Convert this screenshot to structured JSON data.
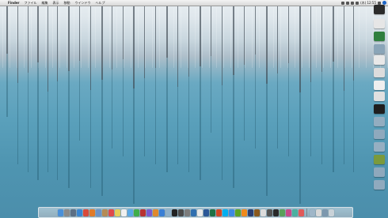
{
  "menubar": {
    "apple_symbol": "",
    "app_name": "Finder",
    "items": [
      "ファイル",
      "編集",
      "表示",
      "移動",
      "ウインドウ",
      "ヘルプ"
    ],
    "clock": "(木) 12:55",
    "status_icons": [
      "wifi-icon",
      "volume-icon",
      "battery-icon",
      "flag-icon",
      "user-icon"
    ]
  },
  "desktop": {
    "wallpaper": "snowy-trees-blue-pond",
    "icons": [
      {
        "name": "hard-drive-icon",
        "color": "#2b2b2b"
      },
      {
        "name": "document-icon",
        "color": "#e6e6e6"
      },
      {
        "name": "app-icon",
        "color": "#2f7f3e"
      },
      {
        "name": "folder-icon",
        "color": "#8aa5b8"
      },
      {
        "name": "document-icon",
        "color": "#e8e8e8"
      },
      {
        "name": "document-icon",
        "color": "#dcdcdc"
      },
      {
        "name": "document-icon",
        "color": "#efefef"
      },
      {
        "name": "document-icon",
        "color": "#e0e0e0"
      },
      {
        "name": "terminal-icon",
        "color": "#1e1e1e"
      },
      {
        "name": "folder-icon",
        "color": "#93adc0"
      },
      {
        "name": "folder-icon",
        "color": "#8fa9bd"
      },
      {
        "name": "folder-icon",
        "color": "#96afc2"
      },
      {
        "name": "image-icon",
        "color": "#7b9a3c"
      },
      {
        "name": "folder-icon",
        "color": "#8ea8bc"
      },
      {
        "name": "folder-icon",
        "color": "#90aabe"
      }
    ]
  },
  "dock": {
    "apps": [
      {
        "name": "finder-icon",
        "color": "#4a90d9"
      },
      {
        "name": "launchpad-icon",
        "color": "#8a8a8a"
      },
      {
        "name": "mission-control-icon",
        "color": "#5b6f85"
      },
      {
        "name": "safari-icon",
        "color": "#3a86d1"
      },
      {
        "name": "chrome-icon",
        "color": "#d94a3a"
      },
      {
        "name": "firefox-icon",
        "color": "#e07b2a"
      },
      {
        "name": "mail-icon",
        "color": "#6b93c9"
      },
      {
        "name": "contacts-icon",
        "color": "#b58b55"
      },
      {
        "name": "calendar-icon",
        "color": "#e04a4a"
      },
      {
        "name": "notes-icon",
        "color": "#e6cf5a"
      },
      {
        "name": "reminders-icon",
        "color": "#f0f0f0"
      },
      {
        "name": "messages-icon",
        "color": "#5aa9e6"
      },
      {
        "name": "facetime-icon",
        "color": "#3fae4a"
      },
      {
        "name": "photo-booth-icon",
        "color": "#b83232"
      },
      {
        "name": "itunes-icon",
        "color": "#7a5bd1"
      },
      {
        "name": "ibooks-icon",
        "color": "#e08a2e"
      },
      {
        "name": "app-store-icon",
        "color": "#3a7fd5"
      },
      {
        "name": "preview-icon",
        "color": "#8fb0c9"
      },
      {
        "name": "terminal-icon",
        "color": "#222222"
      },
      {
        "name": "activity-monitor-icon",
        "color": "#4a4a4a"
      },
      {
        "name": "system-preferences-icon",
        "color": "#7c7c7c"
      },
      {
        "name": "xcode-icon",
        "color": "#2f6fb0"
      },
      {
        "name": "textedit-icon",
        "color": "#e8e8e8"
      },
      {
        "name": "word-icon",
        "color": "#2b5797"
      },
      {
        "name": "excel-icon",
        "color": "#1e7145"
      },
      {
        "name": "powerpoint-icon",
        "color": "#d24726"
      },
      {
        "name": "skype-icon",
        "color": "#00aff0"
      },
      {
        "name": "dropbox-icon",
        "color": "#3d8ae3"
      },
      {
        "name": "evernote-icon",
        "color": "#5ba525"
      },
      {
        "name": "vlc-icon",
        "color": "#f08a1c"
      },
      {
        "name": "photoshop-icon",
        "color": "#2a3f72"
      },
      {
        "name": "illustrator-icon",
        "color": "#8a5a1e"
      },
      {
        "name": "clock-icon",
        "color": "#dcdcdc"
      },
      {
        "name": "calculator-icon",
        "color": "#555555"
      },
      {
        "name": "dashboard-icon",
        "color": "#2a2a2a"
      },
      {
        "name": "app-icon",
        "color": "#5aa05a"
      },
      {
        "name": "app-icon",
        "color": "#c84a8a"
      },
      {
        "name": "app-icon",
        "color": "#4ab0a0"
      },
      {
        "name": "app-icon",
        "color": "#e05a5a"
      }
    ],
    "stacks": [
      {
        "name": "applications-stack-icon",
        "color": "#9fb6c8"
      },
      {
        "name": "documents-stack-icon",
        "color": "#d8d8d8"
      },
      {
        "name": "downloads-stack-icon",
        "color": "#7d98ae"
      },
      {
        "name": "trash-icon",
        "color": "#c9d2d8"
      }
    ]
  }
}
